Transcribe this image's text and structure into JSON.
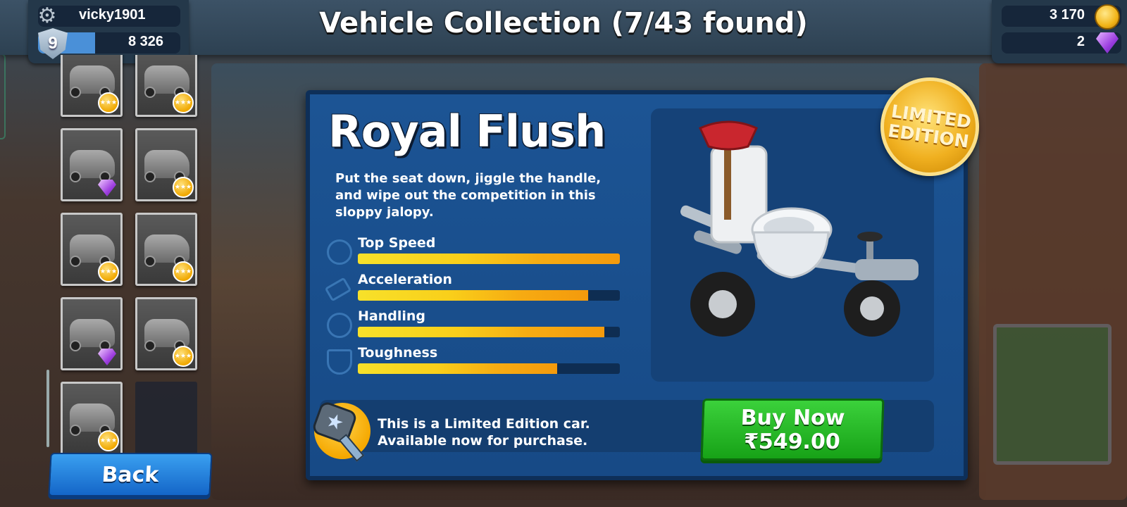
{
  "header": {
    "title": "Vehicle Collection (7/43 found)"
  },
  "profile": {
    "username": "vicky1901",
    "level": "9",
    "xp": "8 326",
    "xp_progress": 0.4
  },
  "currency": {
    "coins": "3 170",
    "gems": "2"
  },
  "vehicle_list": {
    "tiles": [
      {
        "badge": "star"
      },
      {
        "badge": "star"
      },
      {
        "badge": "gem"
      },
      {
        "badge": "star"
      },
      {
        "badge": "star"
      },
      {
        "badge": "star"
      },
      {
        "badge": "gem"
      },
      {
        "badge": "star"
      },
      {
        "badge": "star"
      },
      {
        "badge": "none"
      }
    ]
  },
  "back_button": {
    "label": "Back"
  },
  "vehicle": {
    "name": "Royal Flush",
    "description": "Put the seat down, jiggle the handle, and wipe out the competition in this sloppy jalopy.",
    "badge": "LIMITED EDITION",
    "stats": [
      {
        "label": "Top Speed",
        "value": 1.0,
        "icon": "speedometer-icon"
      },
      {
        "label": "Acceleration",
        "value": 0.88,
        "icon": "tire-tread-icon"
      },
      {
        "label": "Handling",
        "value": 0.94,
        "icon": "steering-wheel-icon"
      },
      {
        "label": "Toughness",
        "value": 0.76,
        "icon": "shield-icon"
      }
    ],
    "limited_note": "This is a Limited Edition car.  Available now for purchase.",
    "buy": {
      "label": "Buy Now",
      "price": "₹549.00"
    }
  },
  "colors": {
    "card_blue": "#1c5494",
    "buy_green": "#17a217",
    "back_blue": "#1466c8",
    "stat_yellow": "#f7e12a",
    "stat_orange": "#f49a0c"
  }
}
